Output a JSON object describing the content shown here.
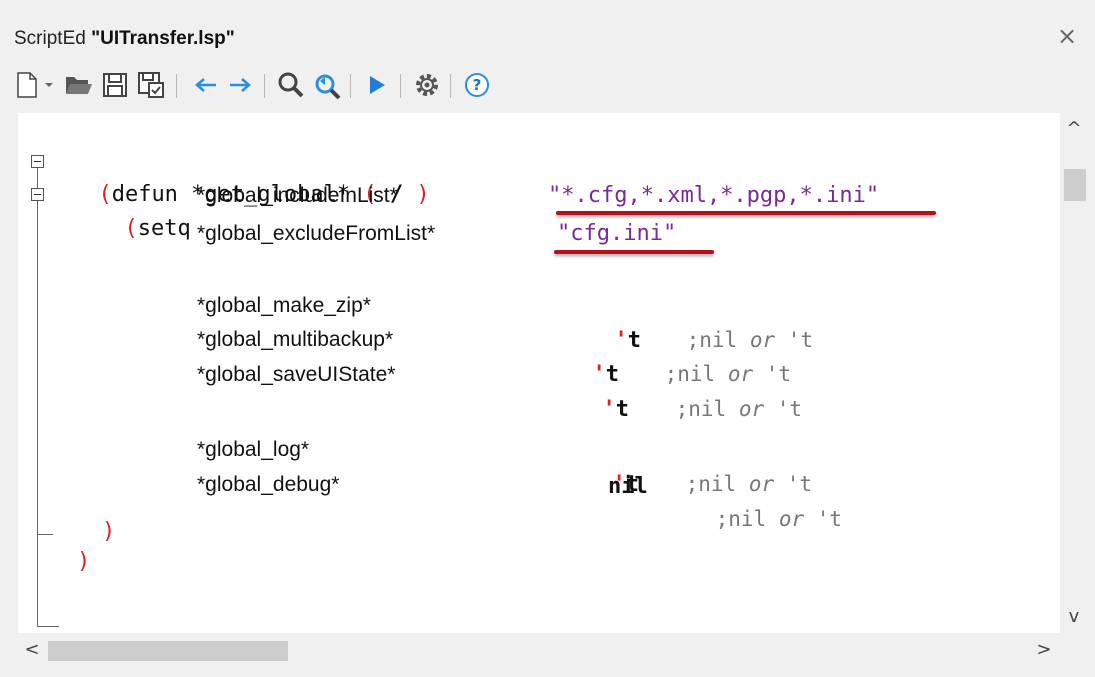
{
  "window": {
    "app": "ScriptEd",
    "file": "\"UITransfer.lsp\"",
    "close_icon": "×"
  },
  "toolbar": {
    "buttons": [
      "new-file-icon",
      "dropdown-icon",
      "open-folder-icon",
      "save-icon",
      "save-all-icon",
      "back-arrow-icon",
      "forward-arrow-icon",
      "find-icon",
      "replace-icon",
      "run-icon",
      "settings-icon",
      "help-icon"
    ],
    "help_glyph": "?"
  },
  "code": {
    "l1_open": "(",
    "l1_kw": "defun *get_global*",
    "l1_args_open": "(",
    "l1_slash": "/",
    "l1_args_close": ")",
    "l2_open": "(",
    "l2_setq": "setq",
    "l2_var": "*global_includeInList*",
    "l2_str": "\"*.cfg,*.xml,*.pgp,*.ini\"",
    "l3_var": "*global_excludeFromList*",
    "l3_str": "\"cfg.ini\"",
    "l5_var": "*global_make_zip*",
    "l6_var": "*global_multibackup*",
    "l7_var": "*global_saveUIState*",
    "l9_var": "*global_log*",
    "l10_var": "*global_debug*",
    "quote": "'",
    "t_val": "t",
    "nil_val": "nil",
    "comment_pre": ";nil",
    "comment_or": "or",
    "comment_post": "'t",
    "close_inner": ")",
    "close_outer": ")"
  },
  "colors": {
    "paren": "#e02020",
    "string": "#7a2a96",
    "underline": "#b0121e",
    "comment": "#777777"
  },
  "scroll": {
    "up": "^",
    "down": "v",
    "left": "<",
    "right": ">"
  }
}
